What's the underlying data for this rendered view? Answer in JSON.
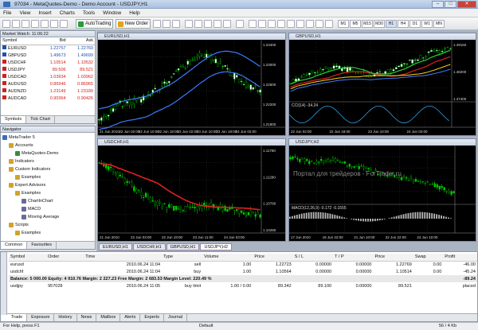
{
  "window": {
    "title": "97034 - MetaQuotes-Demo - Demo Account - USDJPY,H1"
  },
  "menu": [
    "File",
    "View",
    "Insert",
    "Charts",
    "Tools",
    "Window",
    "Help"
  ],
  "toolbar": {
    "autotrading": "AutoTrading",
    "new_order": "New Order",
    "tf": [
      "M1",
      "M5",
      "M15",
      "M30",
      "H1",
      "H4",
      "D1",
      "W1",
      "MN"
    ]
  },
  "market_watch": {
    "title": "Market Watch: 11:06:22",
    "columns": [
      "Symbol",
      "Bid",
      "Ask"
    ],
    "rows": [
      {
        "s": "EURUSD",
        "b": "1.22757",
        "a": "1.22769",
        "c": "#1f4fb0"
      },
      {
        "s": "GBPUSD",
        "b": "1.49673",
        "a": "1.49699",
        "c": "#1f4fb0"
      },
      {
        "s": "USDCHF",
        "b": "1.10514",
        "a": "1.10532",
        "c": "#d0201a"
      },
      {
        "s": "USDJPY",
        "b": "89.506",
        "a": "89.521",
        "c": "#d0201a"
      },
      {
        "s": "USDCAD",
        "b": "1.03934",
        "a": "1.03962",
        "c": "#d0201a"
      },
      {
        "s": "AUDUSD",
        "b": "0.86946",
        "a": "0.86965",
        "c": "#d0201a"
      },
      {
        "s": "AUDNZD",
        "b": "1.23149",
        "a": "1.23189",
        "c": "#d0201a"
      },
      {
        "s": "AUDCAD",
        "b": "0.90364",
        "a": "0.90426",
        "c": "#d0201a"
      }
    ],
    "tabs": [
      "Symbols",
      "Tick Chart"
    ]
  },
  "navigator": {
    "title": "Navigator",
    "items": [
      {
        "t": "MetaTrader 5",
        "lvl": 0,
        "c": "#3a6db5"
      },
      {
        "t": "Accounts",
        "lvl": 1,
        "c": "#d2a32b"
      },
      {
        "t": "MetaQuotes-Demo",
        "lvl": 2,
        "c": "#3a8a3a"
      },
      {
        "t": "Indicators",
        "lvl": 1,
        "c": "#d2a32b"
      },
      {
        "t": "Custom Indicators",
        "lvl": 1,
        "c": "#d2a32b"
      },
      {
        "t": "Examples",
        "lvl": 2,
        "c": "#d2a32b"
      },
      {
        "t": "Expert Advisors",
        "lvl": 1,
        "c": "#d2a32b"
      },
      {
        "t": "Examples",
        "lvl": 2,
        "c": "#d2a32b"
      },
      {
        "t": "ChartInChart",
        "lvl": 3,
        "c": "#6a6a9a"
      },
      {
        "t": "MACD",
        "lvl": 3,
        "c": "#6a6a9a"
      },
      {
        "t": "Moving Average",
        "lvl": 3,
        "c": "#6a6a9a"
      },
      {
        "t": "Scripts",
        "lvl": 1,
        "c": "#d2a32b"
      },
      {
        "t": "Examples",
        "lvl": 2,
        "c": "#d2a32b"
      }
    ],
    "tabs": [
      "Common",
      "Favourites"
    ]
  },
  "charts": [
    {
      "title": "EURUSD,H1",
      "prices": [
        "1.23400",
        "1.23000",
        "1.22600",
        "1.22200",
        "1.21800"
      ],
      "dates": [
        "21 Jun 2010",
        "22 Jun 02:00",
        "22 Jun 10:00",
        "22 Jun 18:00",
        "23 Jun 02:00",
        "23 Jun 10:00",
        "23 Jun 18:00",
        "24 Jun 02:00"
      ]
    },
    {
      "title": "GBPUSD,H1",
      "prices": [
        "1.49150",
        "1.48200",
        "1.47400"
      ],
      "indicator": "CCI(14) -34.24",
      "dates": [
        "22 Jun 02:00",
        "22 Jun 18:00",
        "23 Jun 10:00",
        "24 Jun 02:00"
      ]
    },
    {
      "title": "USDCHF,H1",
      "prices": [
        "1.11780",
        "1.11280",
        "1.10780",
        "1.10280"
      ],
      "dates": [
        "21 Jun 2010",
        "22 Jun 03:00",
        "22 Jun 19:00",
        "23 Jun 11:00",
        "24 Jun 03:00"
      ]
    },
    {
      "title": "USDJPY,H2",
      "watermark": "Портал для трейдеров - ForTrader.ru",
      "indicator": "MACD(12,26,9) -0.172 -0.1555",
      "dates": [
        "17 Jun 2010",
        "18 Jun 22:00",
        "21 Jun 10:00",
        "22 Jun 22:00",
        "24 Jun 10:00"
      ]
    }
  ],
  "chart_tabs": [
    "EURUSD,H1",
    "USDCHF,H1",
    "GBPUSD,H1",
    "USDJPY,H2"
  ],
  "terminal": {
    "columns": [
      "Symbol",
      "Order",
      "Time",
      "Type",
      "Volume",
      "Price",
      "S / L",
      "T / P",
      "Price",
      "Swap",
      "Profit"
    ],
    "rows": [
      [
        "eurusd",
        "",
        "2010.06.24 11:04",
        "sell",
        "1.00",
        "1.22723",
        "0.00000",
        "0.00000",
        "1.22769",
        "0.00",
        "-46.00"
      ],
      [
        "usdchf",
        "",
        "2010.06.24 11:04",
        "buy",
        "1.00",
        "1.10564",
        "0.00000",
        "0.00000",
        "1.10514",
        "0.00",
        "-45.24"
      ]
    ],
    "balance": "Balance: 5 000.00  Equity: 4 910.76  Margin: 2 227.23  Free Margin: 2 683.53  Margin Level: 220.49 %",
    "balance_profit": "-89.24",
    "pending": [
      "usdjpy",
      "957028",
      "2010.06.24 11:05",
      "buy limit",
      "1.00 / 0.00",
      "89.342",
      "89.100",
      "0.00000",
      "89.521",
      "",
      "placed"
    ],
    "tabs": [
      "Trade",
      "Exposure",
      "History",
      "News",
      "Mailbox",
      "Alerts",
      "Experts",
      "Journal"
    ]
  },
  "status": {
    "help": "For Help, press F1",
    "profile": "Default",
    "traffic": "56 / 4 Kb"
  }
}
